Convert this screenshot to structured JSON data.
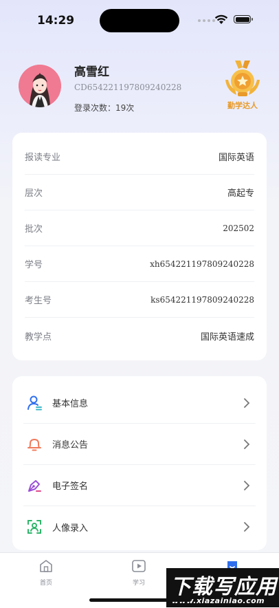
{
  "status_bar": {
    "time": "14:29"
  },
  "profile": {
    "name": "高雪红",
    "id": "CD654221197809240228",
    "login_count": "登录次数：19次",
    "badge_label": "勤学达人"
  },
  "info": [
    {
      "label": "报读专业",
      "value": "国际英语"
    },
    {
      "label": "层次",
      "value": "高起专"
    },
    {
      "label": "批次",
      "value": "202502"
    },
    {
      "label": "学号",
      "value": "xh654221197809240228"
    },
    {
      "label": "考生号",
      "value": "ks654221197809240228"
    },
    {
      "label": "教学点",
      "value": "国际英语速成"
    }
  ],
  "menu": [
    {
      "label": "基本信息",
      "icon": "user-profile-icon"
    },
    {
      "label": "消息公告",
      "icon": "bell-icon"
    },
    {
      "label": "电子签名",
      "icon": "pen-nib-icon"
    },
    {
      "label": "人像录入",
      "icon": "face-scan-icon"
    }
  ],
  "tabs": [
    {
      "label": "首页",
      "icon": "home-icon"
    },
    {
      "label": "学习",
      "icon": "play-icon"
    },
    {
      "label": "",
      "icon": "profile-tab-icon"
    }
  ],
  "watermark": {
    "main": "下载写应用",
    "sub": "www.xiazainiao.com"
  },
  "colors": {
    "accent": "#2f6fed",
    "badge": "#f0a030",
    "avatar_bg": "#f07a92"
  }
}
